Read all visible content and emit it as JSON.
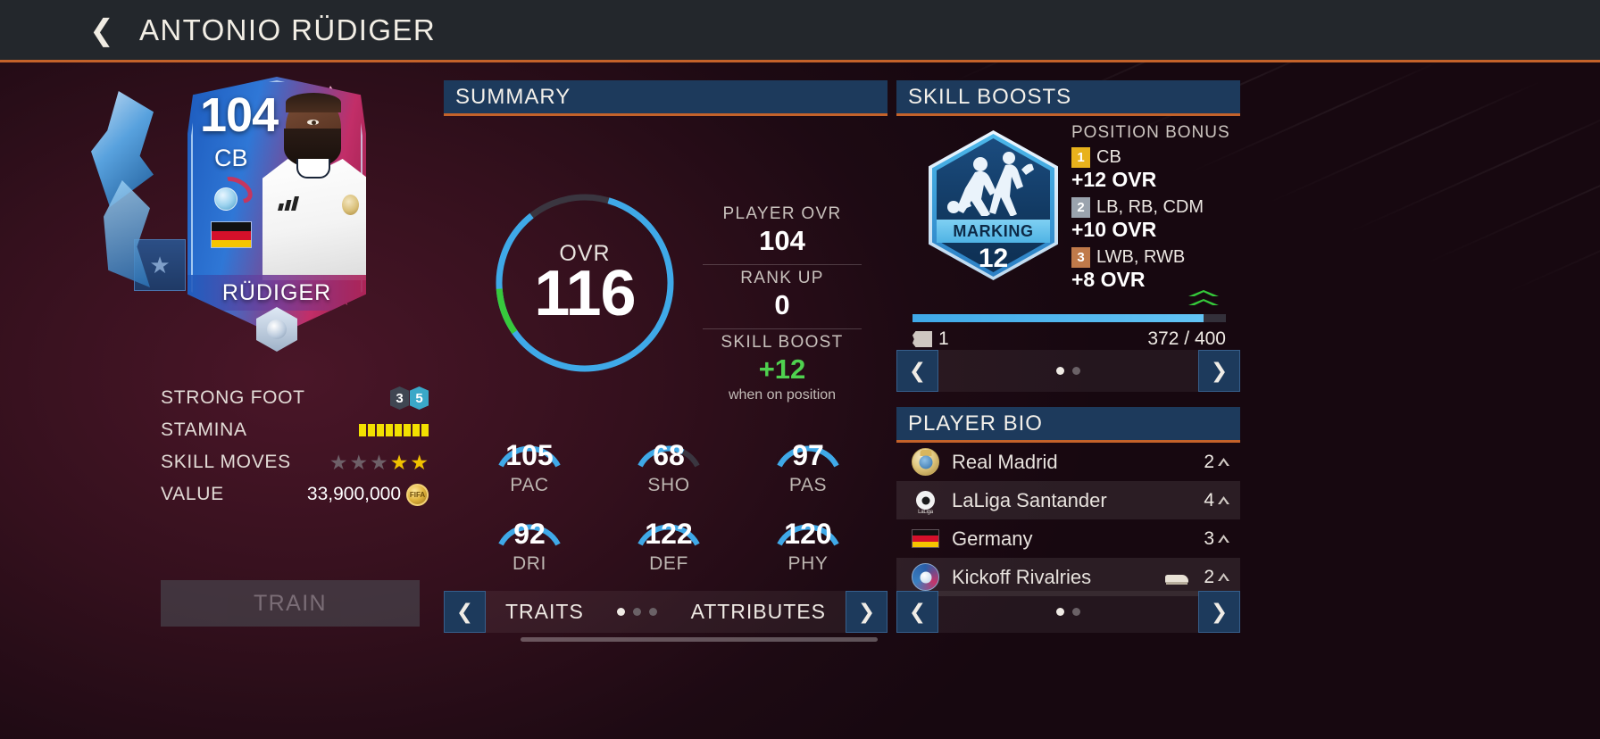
{
  "header": {
    "back_icon": "chevron-left-icon",
    "title": "ANTONIO RÜDIGER"
  },
  "card": {
    "ovr": "104",
    "position": "CB",
    "name": "RÜDIGER",
    "style_icon": "play-style-icon",
    "nation_icon": "germany-flag-icon",
    "chem_icon": "chemistry-icon",
    "star_icon": "★"
  },
  "attributes_list": [
    {
      "label": "STRONG FOOT",
      "type": "foot",
      "weak": "3",
      "strong": "5"
    },
    {
      "label": "STAMINA",
      "type": "bars",
      "filled": 8
    },
    {
      "label": "SKILL MOVES",
      "type": "stars",
      "grey": 3,
      "gold": 2
    },
    {
      "label": "VALUE",
      "type": "value",
      "value": "33,900,000",
      "coin_label": "FIFA"
    }
  ],
  "train_button": "TRAIN",
  "summary": {
    "title": "SUMMARY",
    "ovr_label": "OVR",
    "ovr_value": "116",
    "blocks": [
      {
        "label": "PLAYER OVR",
        "value": "104",
        "green": false
      },
      {
        "label": "RANK UP",
        "value": "0",
        "green": false
      },
      {
        "label": "SKILL BOOST",
        "value": "+12",
        "green": true,
        "sub": "when on position"
      }
    ],
    "arcs": [
      {
        "value": "105",
        "label": "PAC",
        "pct": 0.78
      },
      {
        "value": "68",
        "label": "SHO",
        "pct": 0.4
      },
      {
        "value": "97",
        "label": "PAS",
        "pct": 0.7
      },
      {
        "value": "92",
        "label": "DRI",
        "pct": 0.64
      },
      {
        "value": "122",
        "label": "DEF",
        "pct": 0.97
      },
      {
        "value": "120",
        "label": "PHY",
        "pct": 0.95
      }
    ],
    "nav": {
      "prev_icon": "chevron-left-icon",
      "next_icon": "chevron-right-icon",
      "left_label": "TRAITS",
      "right_label": "ATTRIBUTES",
      "dots": 3,
      "active_dot": 0
    }
  },
  "skill_boosts": {
    "title": "SKILL BOOSTS",
    "badge": {
      "name": "MARKING",
      "level": "12",
      "icon": "marking-skill-icon"
    },
    "position_bonus_title": "POSITION BONUS",
    "bonuses": [
      {
        "rank": "1",
        "tier": "gold",
        "positions": "CB",
        "ovr": "+12 OVR"
      },
      {
        "rank": "2",
        "tier": "silver",
        "positions": "LB, RB, CDM",
        "ovr": "+10 OVR"
      },
      {
        "rank": "3",
        "tier": "bronze",
        "positions": "LWB, RWB",
        "ovr": "+8 OVR"
      }
    ],
    "upgrade_icon": "double-chevron-up-icon",
    "progress": {
      "current": "372",
      "max": "400",
      "separator": "/",
      "tickets": "1",
      "pct": 0.93
    },
    "nav": {
      "prev_icon": "chevron-left-icon",
      "next_icon": "chevron-right-icon",
      "dots": 2,
      "active_dot": 0
    }
  },
  "player_bio": {
    "title": "PLAYER BIO",
    "rows": [
      {
        "icon": "real-madrid-crest-icon",
        "name": "Real Madrid",
        "count": "2",
        "extra_icon": ""
      },
      {
        "icon": "laliga-santander-icon",
        "name": "LaLiga Santander",
        "count": "4",
        "extra_icon": ""
      },
      {
        "icon": "germany-flag-icon",
        "name": "Germany",
        "count": "3",
        "extra_icon": ""
      },
      {
        "icon": "kickoff-rivalries-icon",
        "name": "Kickoff Rivalries",
        "count": "2",
        "extra_icon": "boot-icon"
      }
    ],
    "nav": {
      "prev_icon": "chevron-left-icon",
      "next_icon": "chevron-right-icon",
      "dots": 2,
      "active_dot": 0
    }
  },
  "colors": {
    "accent_orange": "#c4622a",
    "panel_header": "#1d3a5c",
    "ring_blue": "#3fa9e8",
    "boost_green": "#4fd14f",
    "stamina_yellow": "#f2e000",
    "star_gold": "#f0c000"
  }
}
